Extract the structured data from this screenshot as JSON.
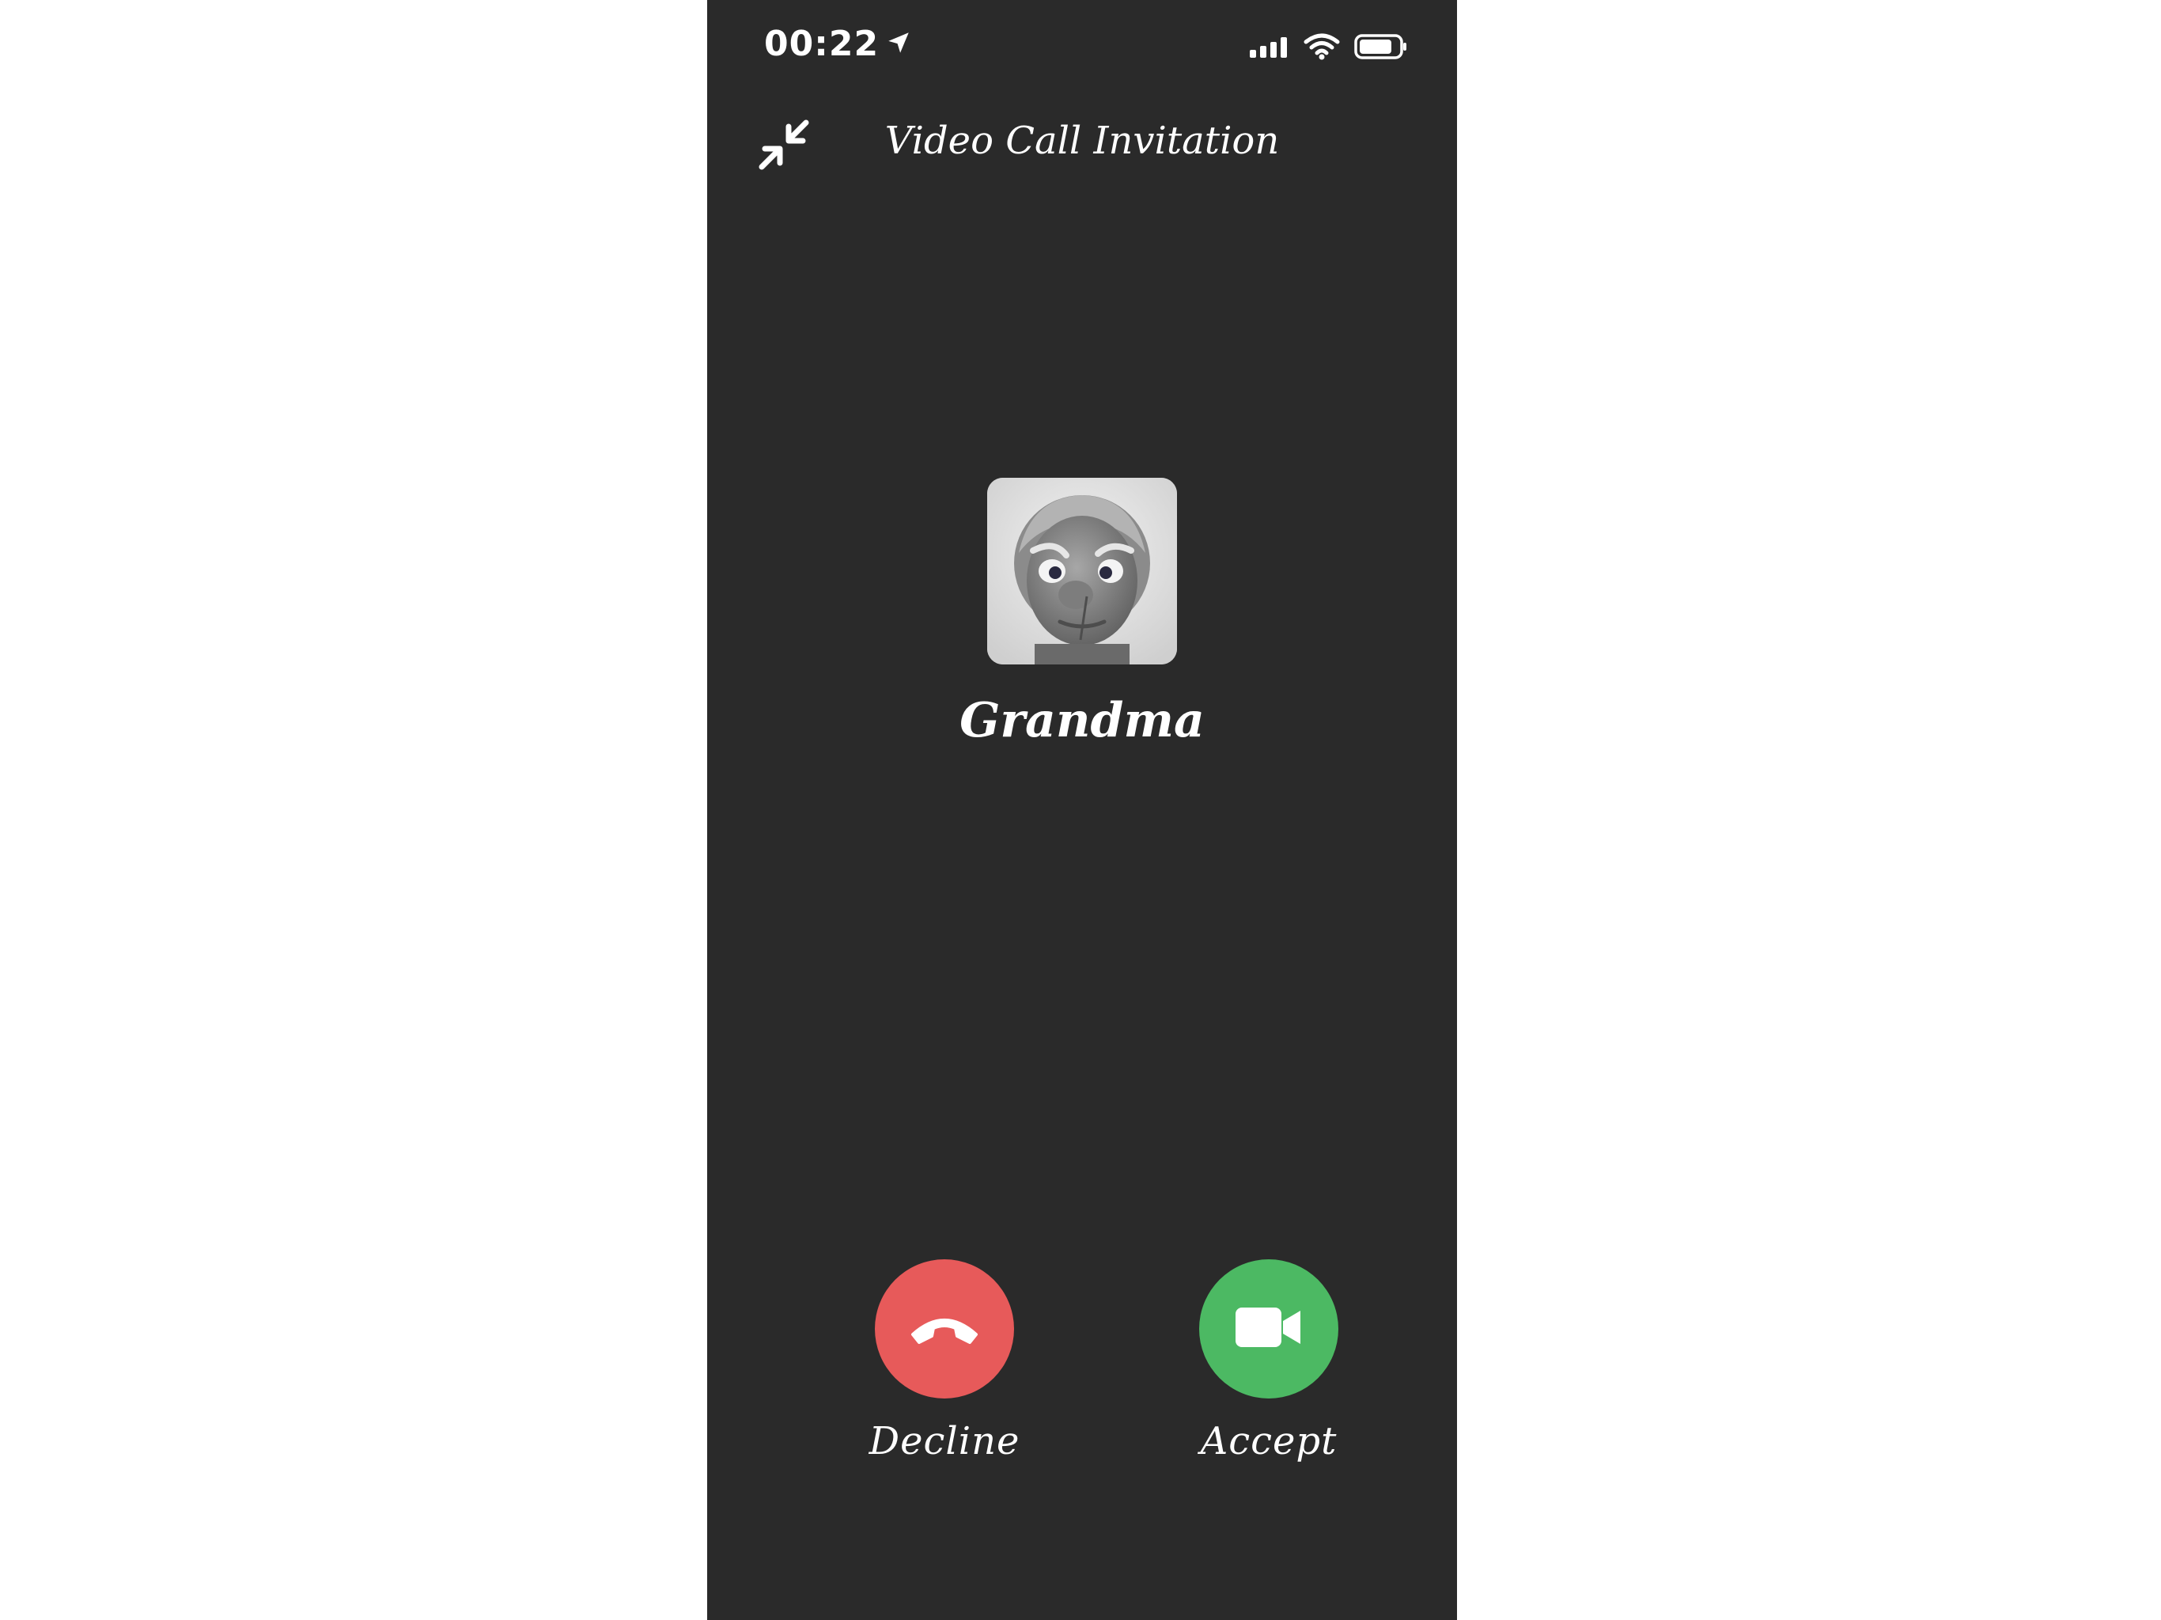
{
  "status_bar": {
    "time": "00:22",
    "location_icon": "location-arrow-icon",
    "signal_icon": "cellular-signal-icon",
    "wifi_icon": "wifi-icon",
    "battery_icon": "battery-icon"
  },
  "header": {
    "title": "Video Call Invitation",
    "minimize_icon": "minimize-arrows-icon"
  },
  "caller": {
    "name": "Grandma",
    "avatar": "caller-avatar"
  },
  "actions": {
    "decline": {
      "label": "Decline",
      "icon": "phone-hangup-icon",
      "color": "#e75a5a"
    },
    "accept": {
      "label": "Accept",
      "icon": "video-camera-icon",
      "color": "#4cb963"
    }
  },
  "colors": {
    "background": "#2a2a2a",
    "page": "#ffffff",
    "text": "#ffffff"
  }
}
